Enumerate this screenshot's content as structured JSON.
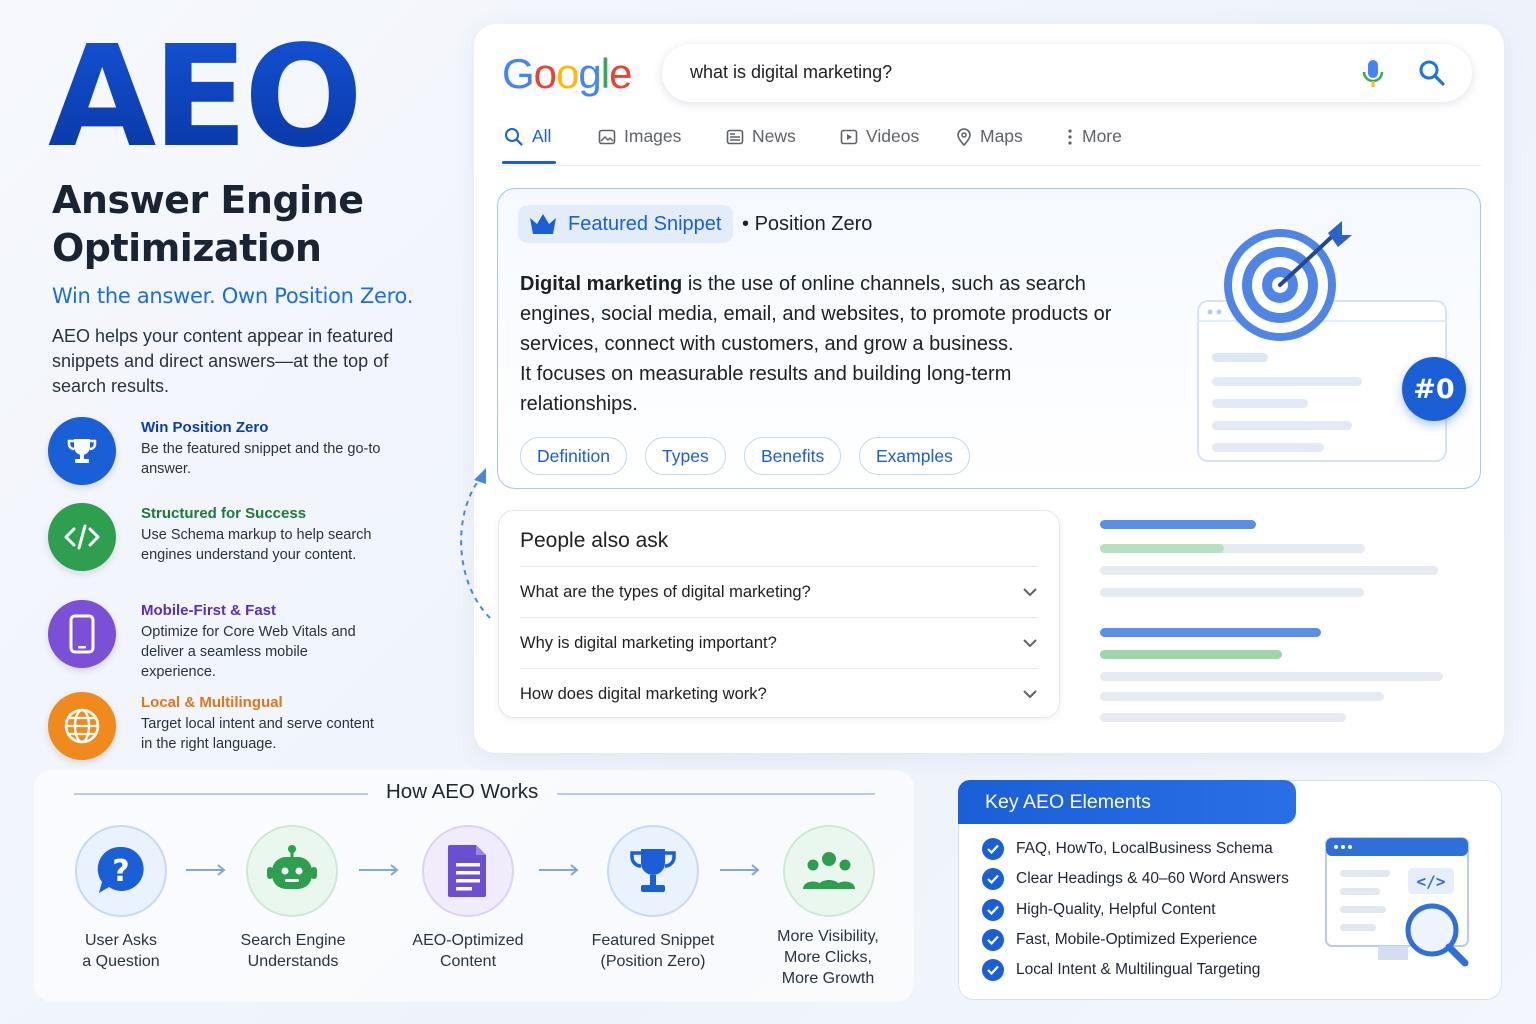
{
  "hero": {
    "title": "AEO",
    "subtitle": "Answer Engine Optimization",
    "tagline": "Win the answer. Own Position Zero.",
    "intro": "AEO helps your content appear in featured snippets and direct answers—at the top of search results."
  },
  "features": [
    {
      "title": "Win Position Zero",
      "desc": "Be the featured snippet and the go-to answer.",
      "icon": "trophy-icon",
      "color": "#1a5fd6",
      "title_color": "#0b3fa8"
    },
    {
      "title": "Structured for Success",
      "desc": "Use Schema markup to help search engines understand your content.",
      "icon": "code-icon",
      "color": "#2e9e4f",
      "title_color": "#1e7a3a"
    },
    {
      "title": "Mobile-First & Fast",
      "desc": "Optimize for Core Web Vitals and deliver a seamless mobile experience.",
      "icon": "mobile-icon",
      "color": "#7b4fd6",
      "title_color": "#5b2fb8"
    },
    {
      "title": "Local & Multilingual",
      "desc": "Target local intent and serve content in the right language.",
      "icon": "globe-icon",
      "color": "#f08a1c",
      "title_color": "#e0761a"
    }
  ],
  "google": {
    "logo": "Google",
    "query": "what is digital marketing?",
    "tabs": [
      "All",
      "Images",
      "News",
      "Videos",
      "Maps",
      "More"
    ],
    "active_tab": "All"
  },
  "snippet": {
    "badge": "Featured Snippet",
    "position": "Position Zero",
    "lead": "Digital marketing",
    "body": " is the use of online channels, such as search engines, social media, email, and websites, to promote products or services, connect with customers, and grow a business.",
    "body2": "It focuses on measurable results and building long-term relationships.",
    "chips": [
      "Definition",
      "Types",
      "Benefits",
      "Examples"
    ],
    "rank_badge": "#0"
  },
  "paa": {
    "title": "People also ask",
    "questions": [
      "What are the types of digital marketing?",
      "Why is digital marketing important?",
      "How does digital marketing work?"
    ]
  },
  "how": {
    "title": "How AEO Works",
    "steps": [
      {
        "label": "User Asks\na Question",
        "icon": "question-icon"
      },
      {
        "label": "Search Engine\nUnderstands",
        "icon": "robot-icon"
      },
      {
        "label": "AEO-Optimized\nContent",
        "icon": "document-icon"
      },
      {
        "label": "Featured Snippet\n(Position Zero)",
        "icon": "trophy-icon"
      },
      {
        "label": "More Visibility,\nMore Clicks,\nMore Growth",
        "icon": "people-icon"
      }
    ]
  },
  "key": {
    "title": "Key AEO Elements",
    "items": [
      "FAQ, HowTo, LocalBusiness Schema",
      "Clear Headings & 40–60 Word Answers",
      "High-Quality, Helpful Content",
      "Fast, Mobile-Optimized Experience",
      "Local Intent & Multilingual Targeting"
    ]
  }
}
